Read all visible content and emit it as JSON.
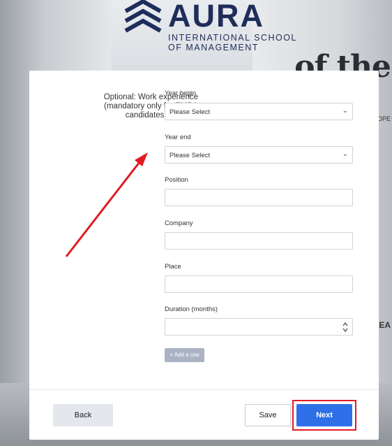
{
  "brand": {
    "name": "AURA",
    "subtitle_line1": "INTERNATIONAL SCHOOL",
    "subtitle_line2": "OF MANAGEMENT",
    "color": "#1f2d5a"
  },
  "background": {
    "wall_text": "of the",
    "wall_small_1": "ROPE",
    "wall_small_2": "OCEA"
  },
  "section": {
    "label_line1": "Optional: Work experience",
    "label_line2": "(mandatory only for EMBA",
    "label_line3": "candidates and gap)"
  },
  "form": {
    "year_begin": {
      "label": "Year begin",
      "value": "Please Select"
    },
    "year_end": {
      "label": "Year end",
      "value": "Please Select"
    },
    "position": {
      "label": "Position",
      "value": ""
    },
    "company": {
      "label": "Company",
      "value": ""
    },
    "place": {
      "label": "Place",
      "value": ""
    },
    "duration": {
      "label": "Duration (months)",
      "value": ""
    },
    "add_row_label": "+ Add a row"
  },
  "footer": {
    "back_label": "Back",
    "save_label": "Save",
    "next_label": "Next"
  },
  "annotations": {
    "highlight_color": "#e01b24",
    "arrow_color": "#e01b24"
  },
  "colors": {
    "primary": "#2f6fe8",
    "add_row": "#a9b3c4",
    "back_bg": "#e5e7ef"
  }
}
